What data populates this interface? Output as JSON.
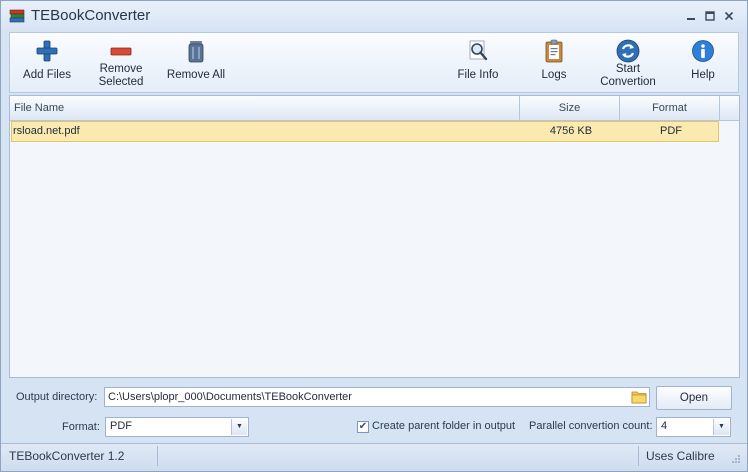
{
  "window": {
    "title": "TEBookConverter"
  },
  "toolbar": {
    "add_files": "Add Files",
    "remove_selected": "Remove\nSelected",
    "remove_all": "Remove All",
    "file_info": "File Info",
    "logs": "Logs",
    "start_convertion": "Start\nConvertion",
    "help": "Help"
  },
  "file_list": {
    "columns": [
      "File Name",
      "Size",
      "Format"
    ],
    "rows": [
      {
        "name": "rsload.net.pdf",
        "size": "4756 KB",
        "format": "PDF",
        "selected": true
      }
    ]
  },
  "output": {
    "label": "Output directory:",
    "path": "C:\\Users\\plopr_000\\Documents\\TEBookConverter",
    "open_label": "Open"
  },
  "format": {
    "label": "Format:",
    "selected": "PDF"
  },
  "options": {
    "create_parent_label": "Create parent folder in output",
    "create_parent_checked": true,
    "parallel_label": "Parallel convertion count:",
    "parallel_value": "4"
  },
  "statusbar": {
    "left": "TEBookConverter 1.2",
    "right": "Uses Calibre"
  },
  "colors": {
    "selection": "#fbeab0",
    "accent": "#2f6fb8",
    "remove": "#c0392b"
  },
  "icons": {
    "app": "app-books-icon",
    "add": "plus-icon",
    "remove_selected": "minus-icon",
    "remove_all": "trash-icon",
    "file_info": "magnifier-icon",
    "logs": "clipboard-icon",
    "start": "refresh-arrows-icon",
    "help": "info-icon",
    "folder": "folder-icon"
  }
}
